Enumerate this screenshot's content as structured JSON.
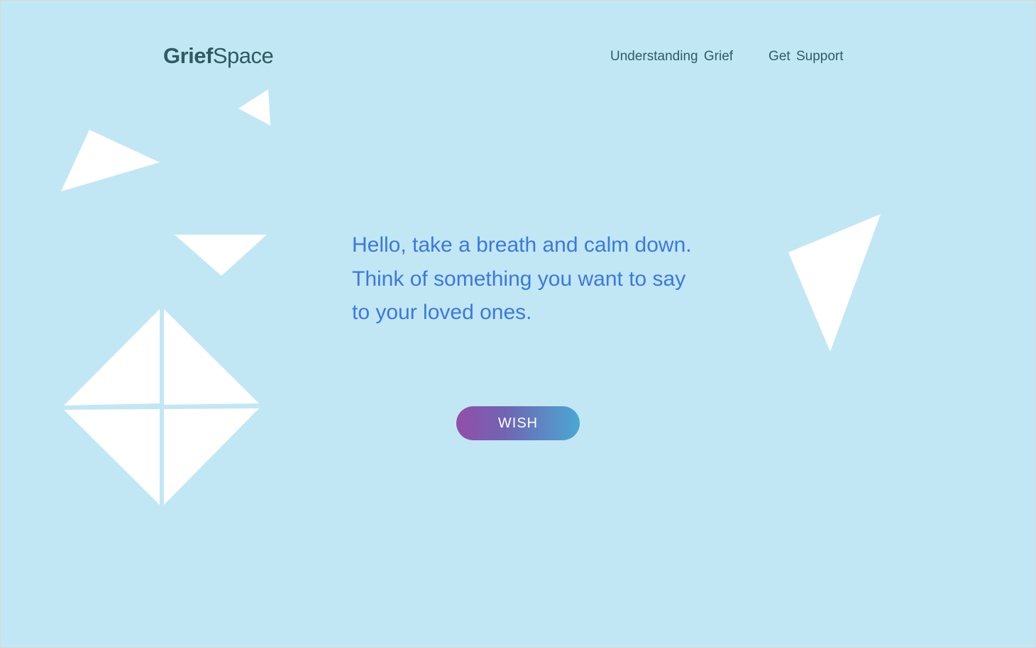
{
  "header": {
    "logo_part1": "Grief",
    "logo_part2": "Space",
    "nav": [
      {
        "label": "Understanding Grief"
      },
      {
        "label": "Get Support"
      }
    ]
  },
  "main": {
    "message": "Hello, take a breath and calm down. Think of something you want to say to your loved ones.",
    "wish_button_label": "WISH"
  },
  "colors": {
    "background": "#c2e7f4",
    "logo": "#2e5a60",
    "nav_text": "#2f5c63",
    "message_text": "#3b78e0",
    "button_gradient_start": "#934ea9",
    "button_gradient_end": "#4aa8d3",
    "shape_fill": "#ffffff"
  }
}
